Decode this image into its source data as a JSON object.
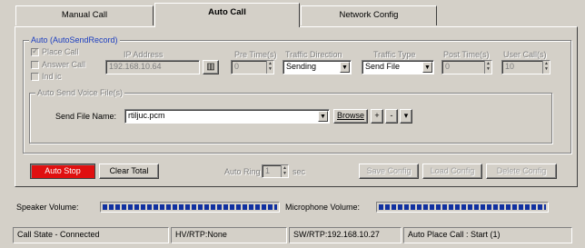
{
  "tabs": [
    {
      "label": "Manual Call"
    },
    {
      "label": "Auto Call"
    },
    {
      "label": "Network Config"
    }
  ],
  "auto": {
    "group_title": "Auto (AutoSendRecord)",
    "place_call": "Place Call",
    "answer_call": "Answer Call",
    "ind_ic": "Ind ic",
    "ip_label": "IP Address",
    "ip_value": "192.168.10.64",
    "pre_time_label": "Pre Time(s)",
    "pre_time_value": "0",
    "traffic_dir_label": "Traffic Direction",
    "traffic_dir_value": "Sending",
    "traffic_type_label": "Traffic Type",
    "traffic_type_value": "Send File",
    "post_time_label": "Post Time(s)",
    "post_time_value": "0",
    "user_calls_label": "User Call(s)",
    "user_calls_value": "10"
  },
  "voice": {
    "group_title": "Auto Send Voice File(s)",
    "send_file_label": "Send File Name:",
    "send_file_value": "rtiljuc.pcm",
    "browse_label": "Browse",
    "plus_label": "+",
    "minus_label": "-",
    "down_label": "▾"
  },
  "controls": {
    "auto_stop": "Auto Stop",
    "clear_total": "Clear Total",
    "auto_ring_label": "Auto Ring",
    "auto_ring_value": "1",
    "sec_label": "sec",
    "save_config": "Save Config",
    "load_config": "Load Config",
    "delete_config": "Delete Config"
  },
  "volume": {
    "speaker_label": "Speaker Volume:",
    "speaker_level": 1.0,
    "mic_label": "Microphone Volume:",
    "mic_level": 1.0
  },
  "status": {
    "call_state": "Call State - Connected",
    "hv_rtp": "HV/RTP:None",
    "sw_rtp": "SW/RTP:192.168.10.27",
    "auto_place": "Auto Place Call : Start (1)"
  },
  "colors": {
    "auto_stop_bg": "#e01010",
    "meter_fill": "#1030a0",
    "legend_blue": "#1c3ec0"
  }
}
